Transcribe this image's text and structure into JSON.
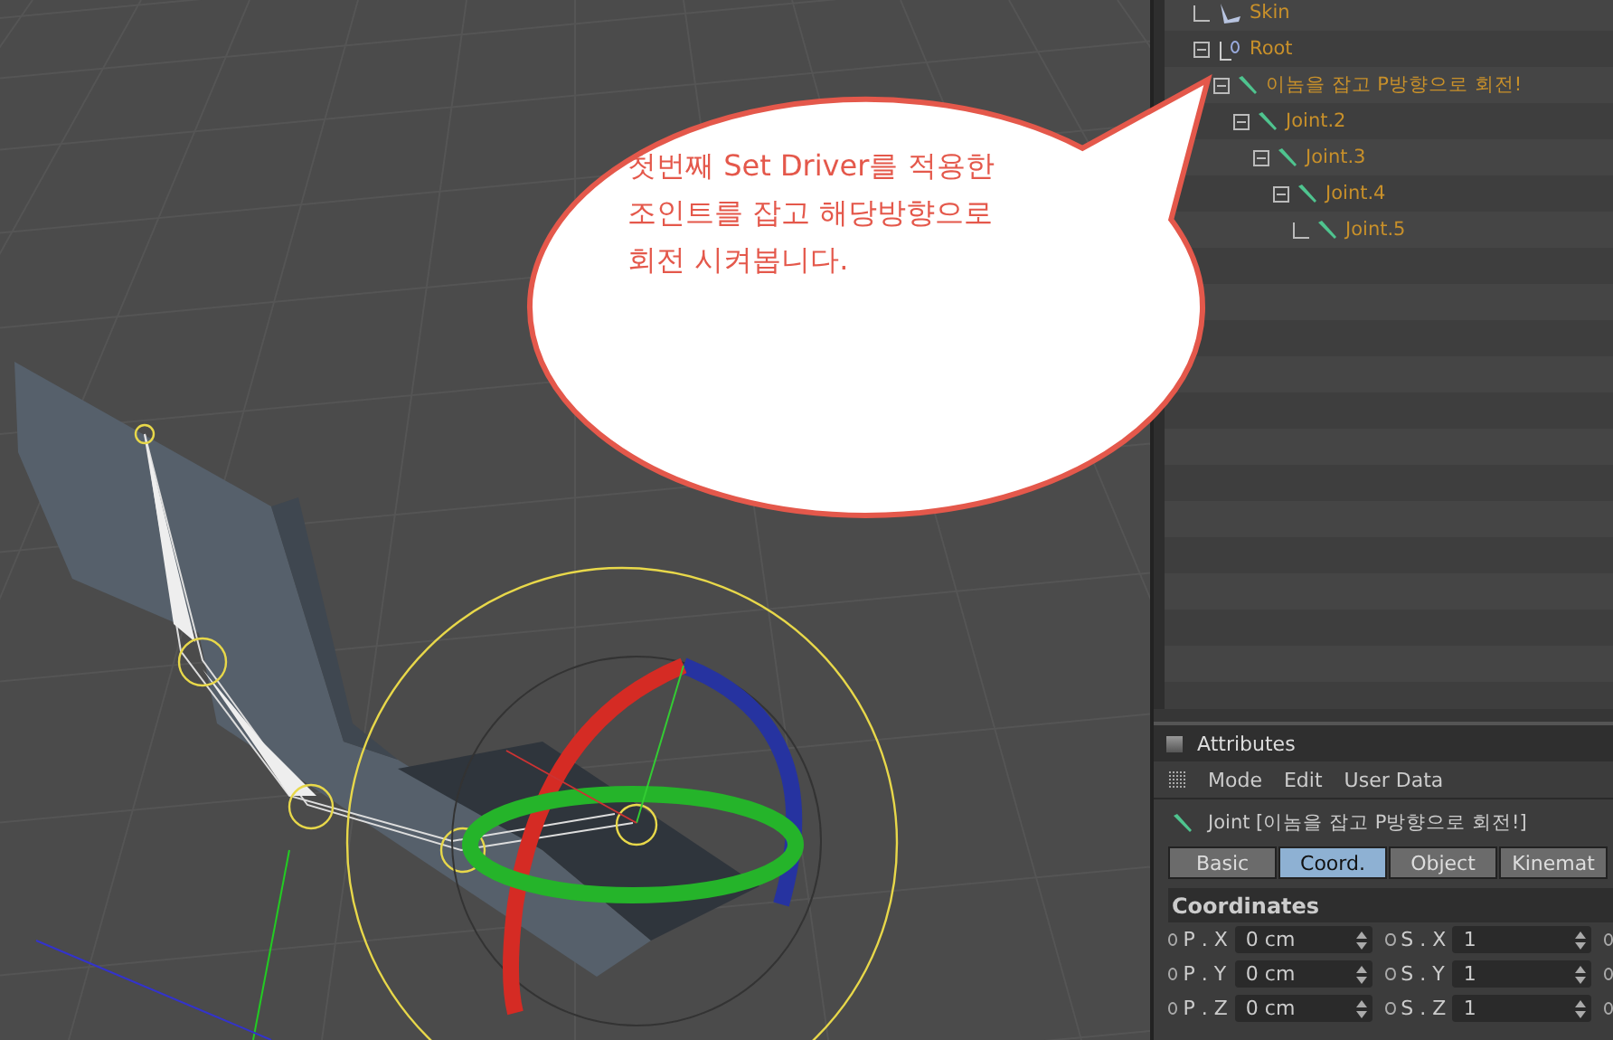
{
  "callout": {
    "lines": [
      "첫번째 Set Driver를 적용한",
      "조인트를 잡고 해당방향으로",
      "회전 시켜봅니다."
    ]
  },
  "object_tree": [
    {
      "label": "Skin",
      "kind": "skin",
      "expanded": false
    },
    {
      "label": "Root",
      "kind": "null",
      "expanded": true,
      "children": [
        {
          "label": "이놈을 잡고 P방향으로 회전!",
          "kind": "joint",
          "expanded": true,
          "children": [
            {
              "label": "Joint.2",
              "kind": "joint",
              "expanded": true,
              "children": [
                {
                  "label": "Joint.3",
                  "kind": "joint",
                  "expanded": true,
                  "children": [
                    {
                      "label": "Joint.4",
                      "kind": "joint",
                      "expanded": true,
                      "children": [
                        {
                          "label": "Joint.5",
                          "kind": "joint",
                          "expanded": false
                        }
                      ]
                    }
                  ]
                }
              ]
            }
          ]
        }
      ]
    }
  ],
  "attributes": {
    "title": "Attributes",
    "menu": [
      "Mode",
      "Edit",
      "User Data"
    ],
    "object_label": "Joint [이놈을 잡고 P방향으로 회전!]",
    "tabs": [
      {
        "label": "Basic",
        "selected": false
      },
      {
        "label": "Coord.",
        "selected": true
      },
      {
        "label": "Object",
        "selected": false
      },
      {
        "label": "Kinemat",
        "selected": false
      }
    ],
    "section": "Coordinates",
    "rows": [
      {
        "cells": [
          {
            "label": "P . X",
            "value": "0 cm"
          },
          {
            "label": "S . X",
            "value": "1"
          }
        ]
      },
      {
        "cells": [
          {
            "label": "P . Y",
            "value": "0 cm"
          },
          {
            "label": "S . Y",
            "value": "1"
          }
        ]
      },
      {
        "cells": [
          {
            "label": "P . Z",
            "value": "0 cm"
          },
          {
            "label": "S . Z",
            "value": "1"
          }
        ]
      }
    ]
  }
}
